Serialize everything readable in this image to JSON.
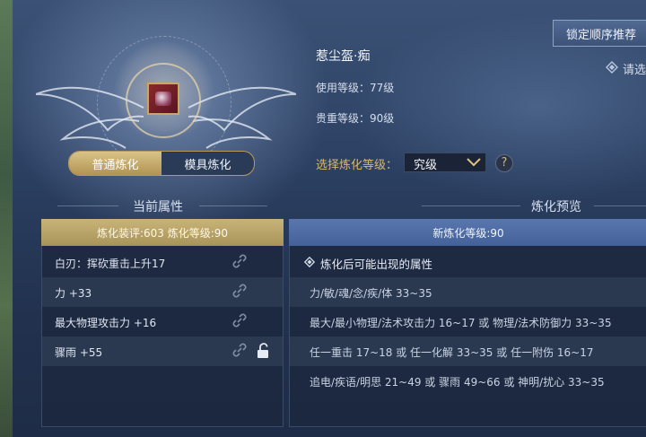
{
  "item": {
    "name": "惹尘盔·痴",
    "use_level": "使用等级：77级",
    "value_level": "贵重等级：90级"
  },
  "tabs": [
    {
      "label": "普通炼化",
      "active": true
    },
    {
      "label": "模具炼化",
      "active": false
    }
  ],
  "top_button": "锁定顺序推荐",
  "hint_text": "请选",
  "refine_select": {
    "label": "选择炼化等级：",
    "value": "究级"
  },
  "help_button": "?",
  "current": {
    "title": "当前属性",
    "header": "炼化装评:603  炼化等级:90",
    "rows": [
      {
        "text": "白刃：挥砍重击上升17",
        "chain": true,
        "lock": false
      },
      {
        "text": "力 +33",
        "chain": true,
        "lock": false
      },
      {
        "text": "最大物理攻击力 +16",
        "chain": true,
        "lock": false
      },
      {
        "text": "骤雨 +55",
        "chain": true,
        "lock": true
      }
    ]
  },
  "preview": {
    "title": "炼化预览",
    "header": "新炼化等级:90",
    "subtitle": "炼化后可能出现的属性",
    "rows": [
      "力/敏/魂/念/疾/体 33~35",
      "最大/最小物理/法术攻击力 16~17 或 物理/法术防御力 33~35",
      "任一重击 17~18 或 任一化解 33~35 或 任一附伤 16~17",
      "追电/疾语/明思 21~49 或 骤雨 49~66 或 神明/扰心 33~35"
    ]
  },
  "colors": {
    "accent_gold": "#c8b478",
    "accent_blue": "#5977ad",
    "label_gold": "#d9b86c"
  }
}
